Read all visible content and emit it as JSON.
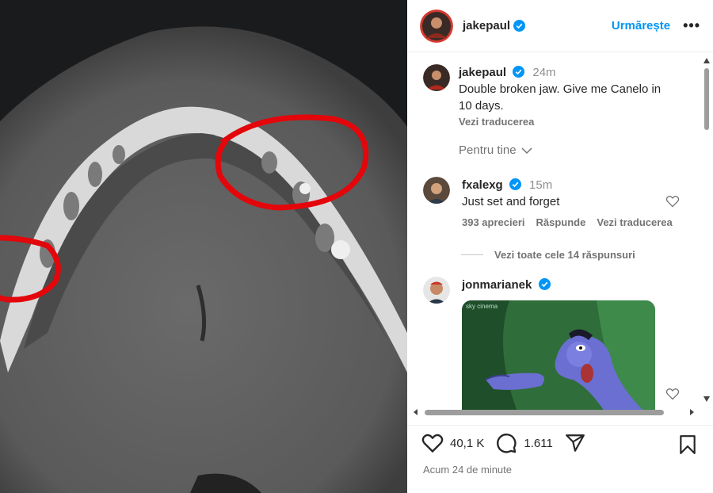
{
  "post": {
    "author": "jakepaul",
    "follow_label": "Urmărește",
    "more_label": "•••",
    "caption_time": "24m",
    "caption": "Double broken jaw. Give me Canelo in 10 days.",
    "caption_line1": "Double broken jaw. Give me Canelo in",
    "caption_line2": "10 days.",
    "translate_label": "Vezi traducerea",
    "for_you_label": "Pentru tine"
  },
  "comments": [
    {
      "author": "fxalexg",
      "time": "15m",
      "text": "Just set and forget",
      "likes": "393 aprecieri",
      "reply_label": "Răspunde",
      "translate_label": "Vezi traducerea",
      "view_replies": "Vezi toate cele 14 răspunsuri"
    },
    {
      "author": "jonmarianek",
      "gif_watermark": "sky cinema"
    }
  ],
  "actions": {
    "likes_count": "40,1 K",
    "comments_count": "1.611",
    "posted_ago": "Acum 24 de minute"
  },
  "icons": [
    "heart-icon",
    "comment-icon",
    "share-icon",
    "bookmark-icon",
    "verified-icon"
  ],
  "colors": {
    "accent": "#0095f6",
    "annotation_red": "#e3060a",
    "muted": "#737373"
  }
}
